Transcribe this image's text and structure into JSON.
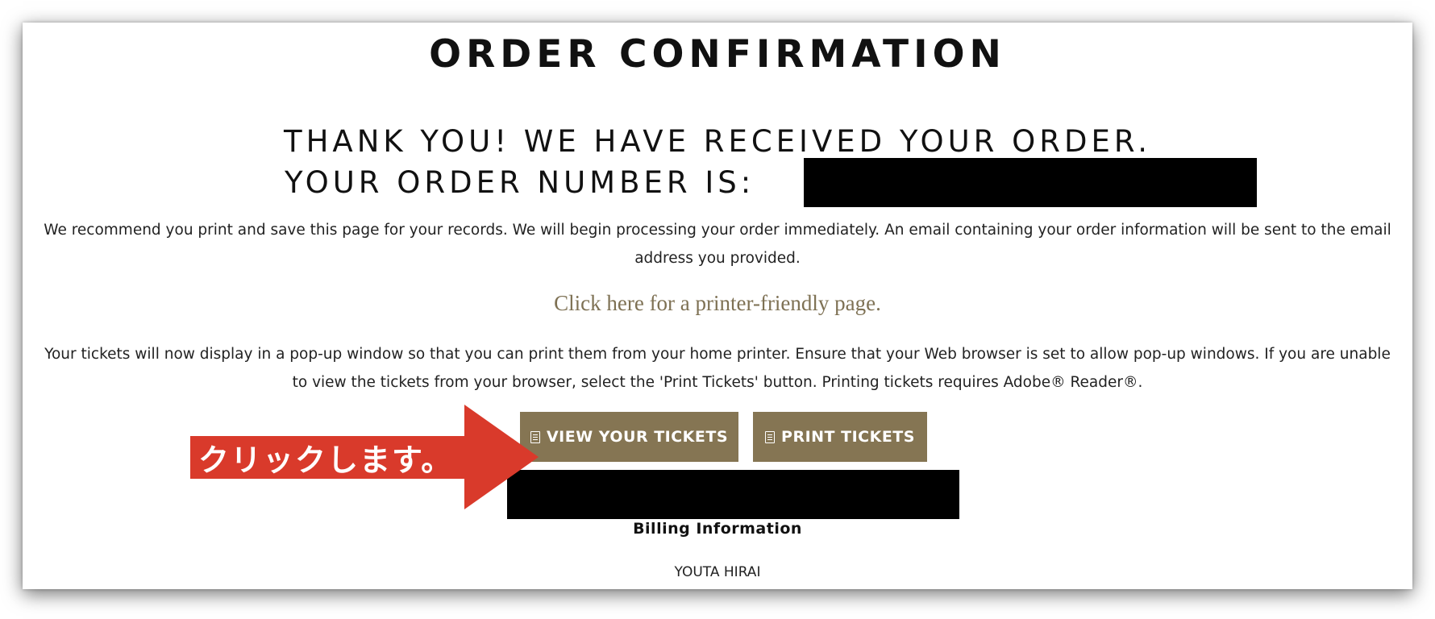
{
  "page": {
    "title": "ORDER CONFIRMATION",
    "thanks_line": "THANK YOU! WE HAVE RECEIVED YOUR ORDER.",
    "order_number_label": "YOUR ORDER NUMBER IS:",
    "records_text": "We recommend you print and save this page for your records. We will begin processing your order immediately. An email containing your order information will be sent to the email address you provided.",
    "printer_link": "Click here for a printer-friendly page.",
    "popup_text": "Your tickets will now display in a pop-up window so that you can print them from your home printer. Ensure that your Web browser is set to allow pop-up windows. If you are unable to view the tickets from your browser, select the 'Print Tickets' button. Printing tickets requires Adobe® Reader®."
  },
  "buttons": {
    "view_tickets": "VIEW YOUR TICKETS",
    "print_tickets": "PRINT TICKETS",
    "view_icon": "document-icon",
    "print_icon": "printer-icon"
  },
  "billing": {
    "title": "Billing Information",
    "name": "YOUTA HIRAI"
  },
  "annotation": {
    "label": "クリックします。",
    "color": "#d93a2b"
  },
  "colors": {
    "accent": "#857553",
    "link": "#7e7154",
    "text": "#111111"
  }
}
